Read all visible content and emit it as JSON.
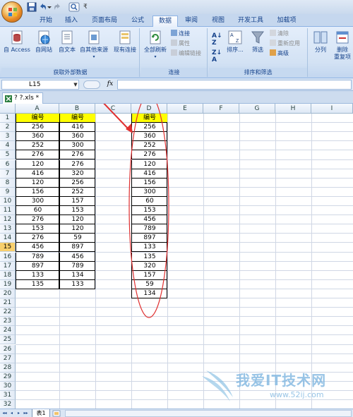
{
  "quick_access": {
    "save_icon": "save-icon",
    "undo_icon": "undo-icon",
    "redo_icon": "redo-icon",
    "print_preview_icon": "print-preview-icon",
    "customize_label": "₹"
  },
  "tabs": [
    {
      "label": "开始"
    },
    {
      "label": "插入"
    },
    {
      "label": "页面布局"
    },
    {
      "label": "公式"
    },
    {
      "label": "数据",
      "active": true
    },
    {
      "label": "审阅"
    },
    {
      "label": "视图"
    },
    {
      "label": "开发工具"
    },
    {
      "label": "加载项"
    }
  ],
  "ribbon": {
    "external": {
      "group_label": "获取外部数据",
      "access": "自 Access",
      "web": "自网站",
      "text": "自文本",
      "other": "自其他来源",
      "existing": "现有连接"
    },
    "connections": {
      "group_label": "连接",
      "refresh_all": "全部刷新",
      "connections": "连接",
      "properties": "属性",
      "edit_links": "编辑链接"
    },
    "sort_filter": {
      "group_label": "排序和筛选",
      "sort": "排序...",
      "filter": "筛选",
      "clear": "清除",
      "reapply": "重新应用",
      "advanced": "高级"
    },
    "data_tools": {
      "split": "分列",
      "remove_dup_line1": "删除",
      "remove_dup_line2": "重复项"
    }
  },
  "formula_bar": {
    "name_box": "L15",
    "fx_label": "fx",
    "formula": ""
  },
  "workbook_tab": {
    "title": "? ?.xls *"
  },
  "grid": {
    "columns": [
      "A",
      "B",
      "C",
      "D",
      "E",
      "F",
      "G",
      "H",
      "I"
    ],
    "rows": [
      "1",
      "2",
      "3",
      "4",
      "5",
      "6",
      "7",
      "8",
      "9",
      "10",
      "11",
      "12",
      "13",
      "14",
      "15",
      "16",
      "17",
      "18",
      "19",
      "20",
      "21",
      "22",
      "23",
      "24",
      "25",
      "26",
      "27",
      "28",
      "29",
      "30",
      "31",
      "32"
    ],
    "selected_row": "15",
    "header_text": "编号",
    "col_a": [
      "256",
      "360",
      "252",
      "276",
      "120",
      "416",
      "120",
      "156",
      "300",
      "60",
      "276",
      "153",
      "276",
      "456",
      "789",
      "897",
      "133",
      "135"
    ],
    "col_b": [
      "416",
      "360",
      "300",
      "276",
      "276",
      "320",
      "256",
      "252",
      "157",
      "153",
      "120",
      "120",
      "59",
      "897",
      "456",
      "789",
      "134",
      "133"
    ],
    "col_d": [
      "256",
      "360",
      "252",
      "276",
      "120",
      "416",
      "156",
      "300",
      "60",
      "153",
      "456",
      "789",
      "897",
      "133",
      "135",
      "320",
      "157",
      "59",
      "134"
    ]
  },
  "annotation": {
    "arrow_color": "#e03030",
    "ellipse_color": "#e03030"
  },
  "sheet_tabs": {
    "active": "表1",
    "nav": [
      "◂◂",
      "◂",
      "▸",
      "▸▸"
    ]
  },
  "watermark": {
    "brand": "我爱IT技术网",
    "url": "www.52ij.com"
  }
}
